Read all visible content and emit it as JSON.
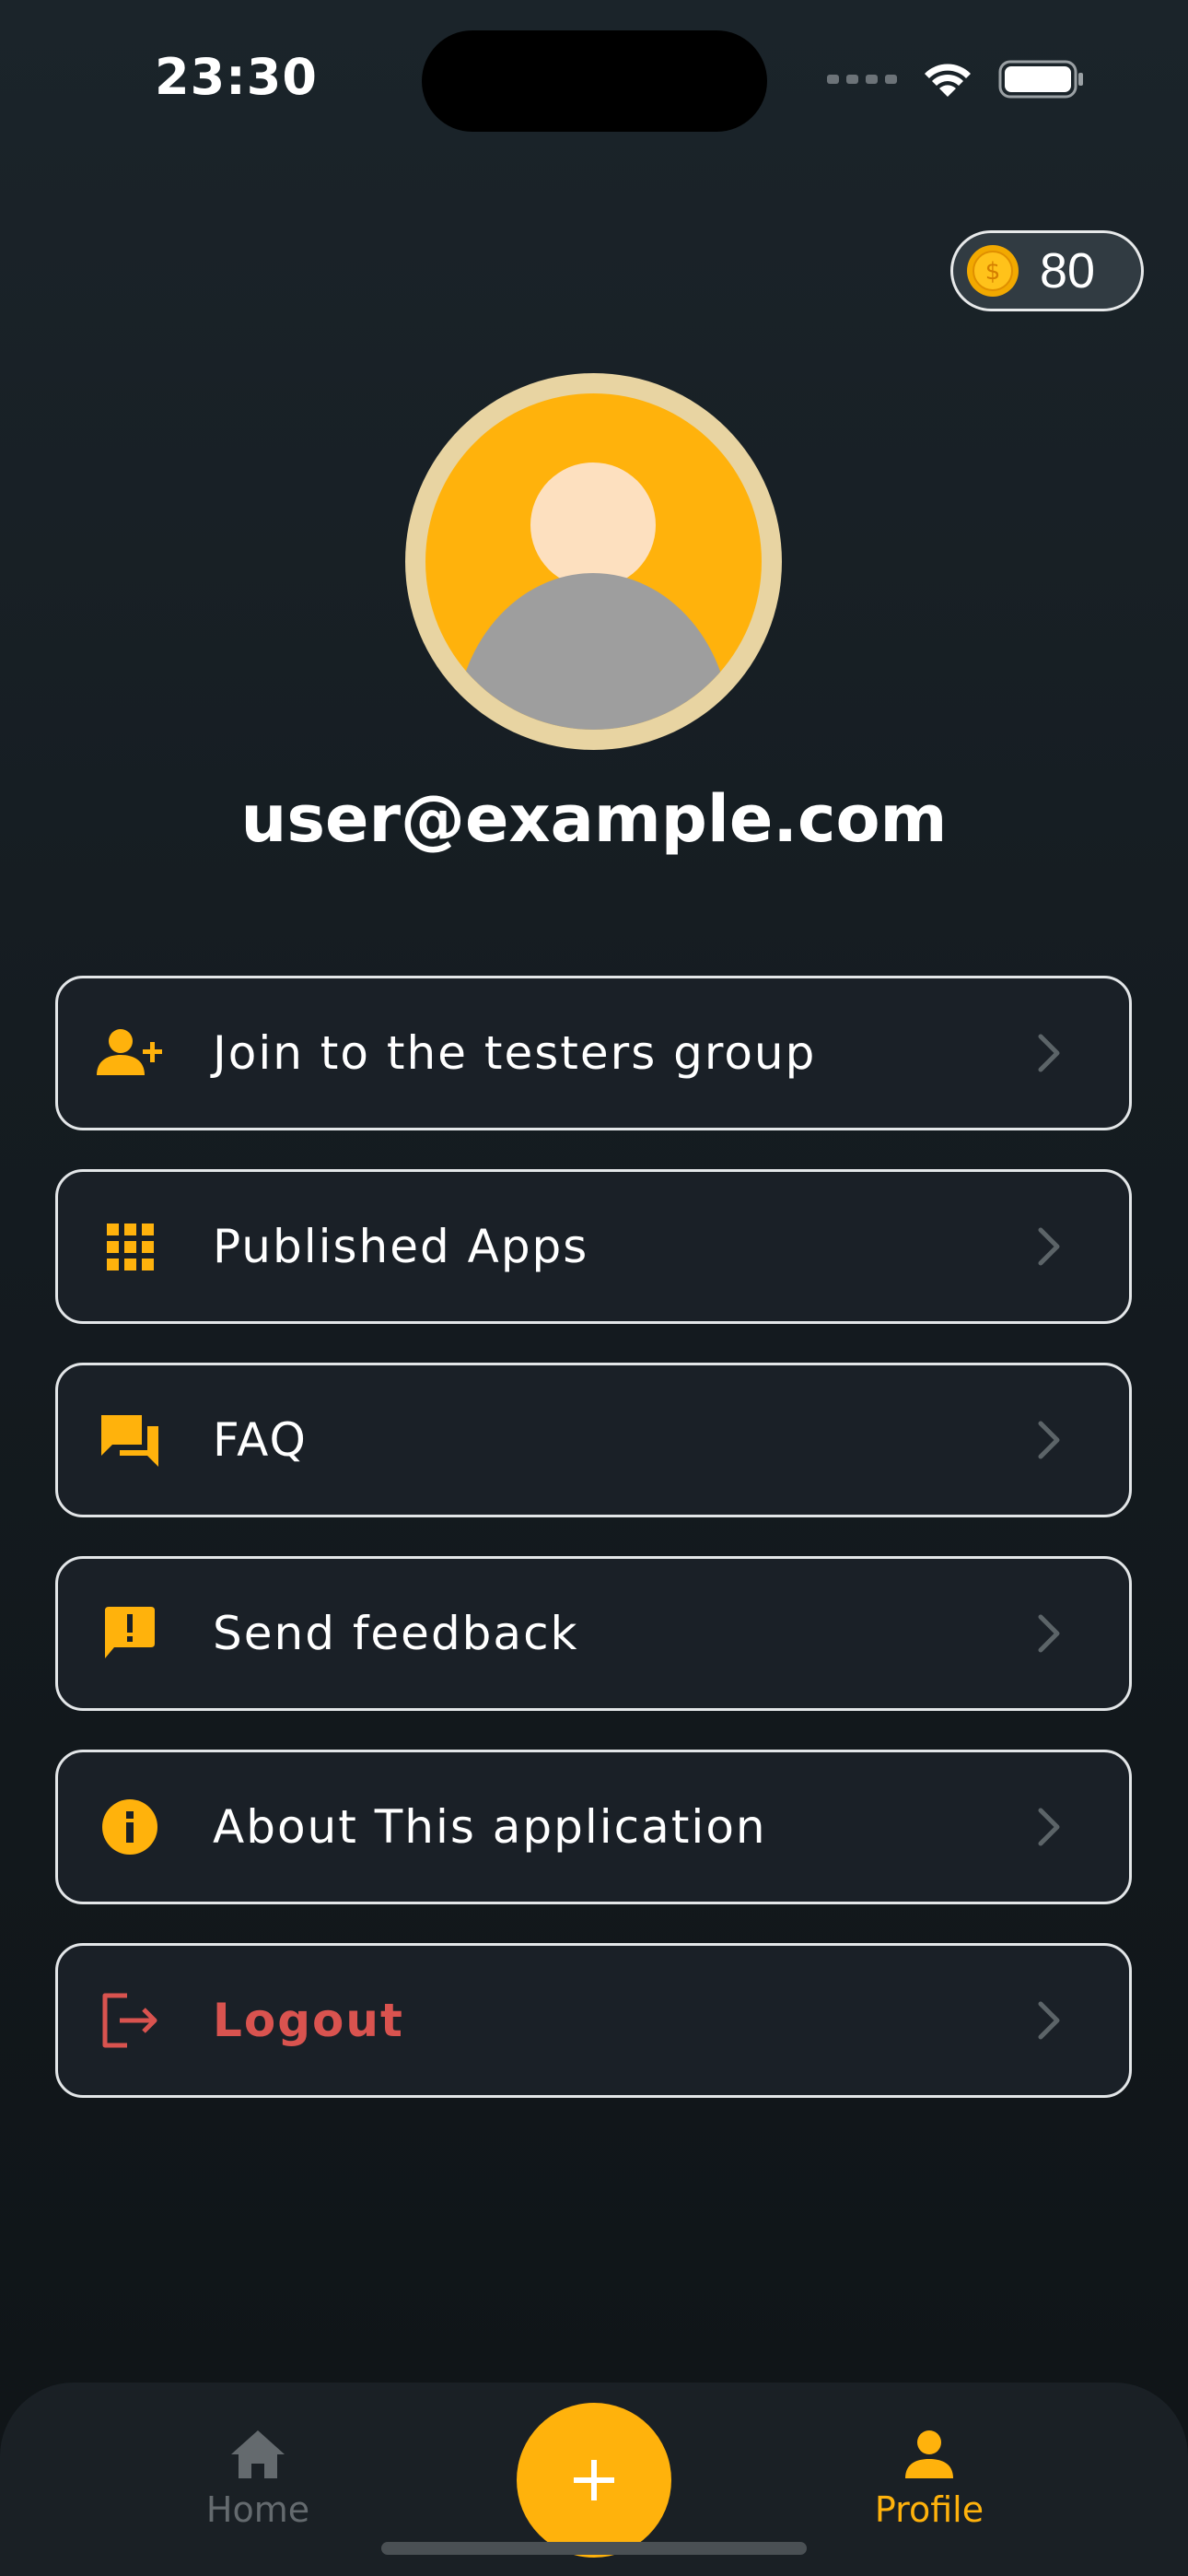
{
  "status_bar": {
    "time": "23:30"
  },
  "coins": {
    "value": "80",
    "icon": "coin-icon"
  },
  "profile": {
    "email": "user@example.com",
    "avatar_icon": "default-user-avatar"
  },
  "menu": {
    "items": [
      {
        "label": "Join to the testers group",
        "icon": "person-add-icon"
      },
      {
        "label": "Published Apps",
        "icon": "apps-grid-icon"
      },
      {
        "label": "FAQ",
        "icon": "forum-icon"
      },
      {
        "label": "Send feedback",
        "icon": "feedback-icon"
      },
      {
        "label": "About This application",
        "icon": "info-icon"
      },
      {
        "label": "Logout",
        "icon": "logout-icon"
      }
    ]
  },
  "bottom_nav": {
    "home_label": "Home",
    "profile_label": "Profile",
    "add_icon": "plus-icon"
  },
  "colors": {
    "accent": "#ffb20c",
    "logout": "#d9534f",
    "background": "#151c21",
    "card": "#1a2027"
  }
}
